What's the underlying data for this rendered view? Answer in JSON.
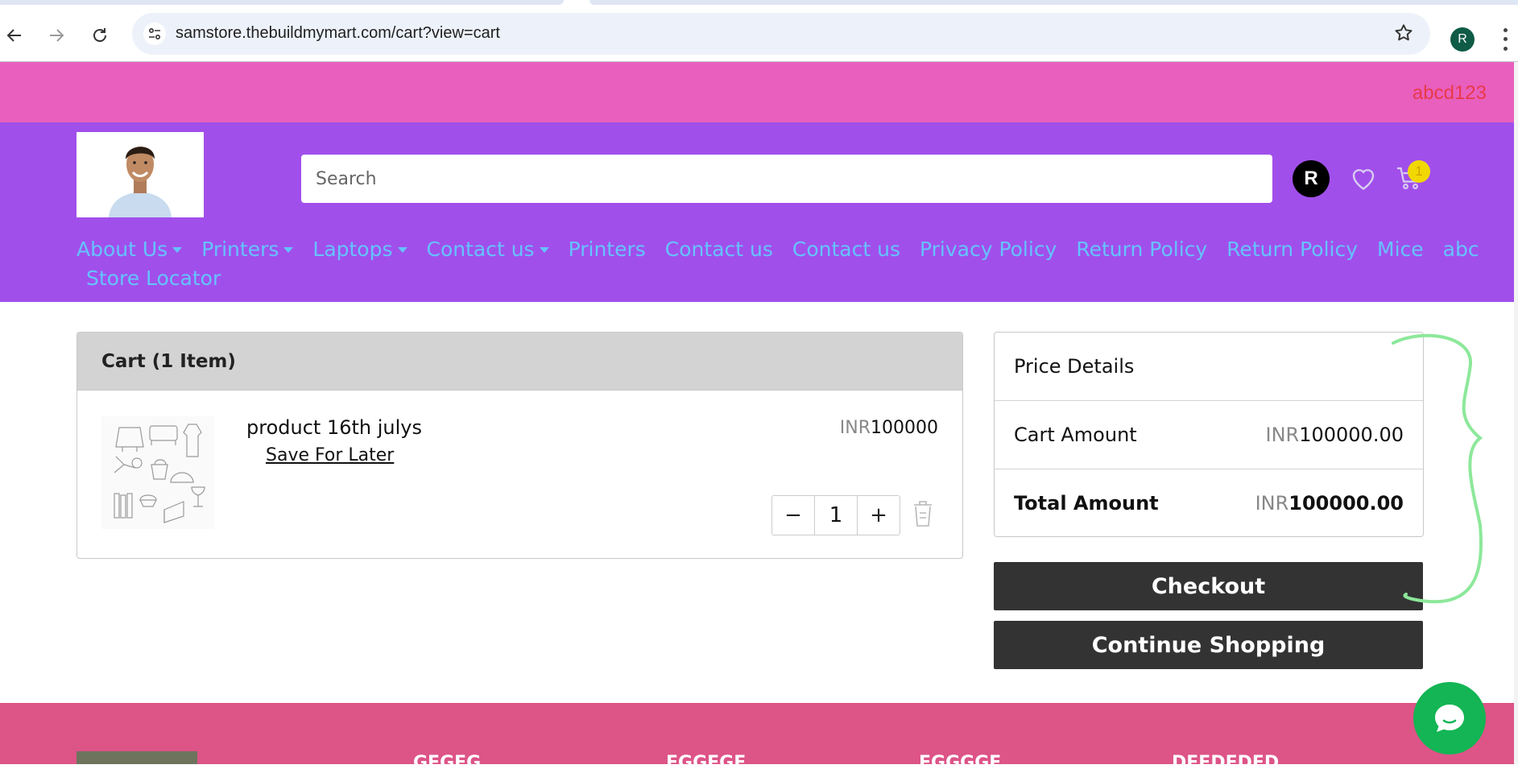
{
  "browser": {
    "url": "samstore.thebuildmymart.com/cart?view=cart",
    "profile_initial": "R"
  },
  "topbar": {
    "code": "abcd123"
  },
  "header": {
    "search_placeholder": "Search",
    "user_initial": "R",
    "cart_count": "1",
    "nav": [
      {
        "label": "About Us",
        "dropdown": true
      },
      {
        "label": "Printers",
        "dropdown": true
      },
      {
        "label": "Laptops",
        "dropdown": true
      },
      {
        "label": "Contact us",
        "dropdown": true
      },
      {
        "label": "Printers",
        "dropdown": false
      },
      {
        "label": "Contact us",
        "dropdown": false
      },
      {
        "label": "Contact us",
        "dropdown": false
      },
      {
        "label": "Privacy Policy",
        "dropdown": false
      },
      {
        "label": "Return Policy",
        "dropdown": false
      },
      {
        "label": "Return Policy",
        "dropdown": false
      },
      {
        "label": "Mice",
        "dropdown": false
      },
      {
        "label": "abc",
        "dropdown": false
      },
      {
        "label": "Store Locator",
        "dropdown": false
      }
    ]
  },
  "cart": {
    "title": "Cart (1 Item)",
    "item": {
      "name": "product 16th julys",
      "save_label": "Save For Later",
      "currency": "INR",
      "price": "100000",
      "quantity": "1",
      "minus": "−",
      "plus": "+"
    }
  },
  "price_details": {
    "title": "Price Details",
    "cart_amount_label": "Cart Amount",
    "cart_amount_currency": "INR",
    "cart_amount_value": "100000.00",
    "total_label": "Total Amount",
    "total_currency": "INR",
    "total_value": "100000.00"
  },
  "actions": {
    "checkout": "Checkout",
    "continue": "Continue Shopping"
  },
  "footer": {
    "columns": [
      "GEGEG",
      "EGGEGE",
      "EGGGGE",
      "DEEDEDED"
    ]
  },
  "colors": {
    "topbar": "#e95fbd",
    "header": "#a14feb",
    "nav_text": "#65c3ff",
    "footer": "#dd5487",
    "chat": "#13b554",
    "button": "#333333"
  }
}
